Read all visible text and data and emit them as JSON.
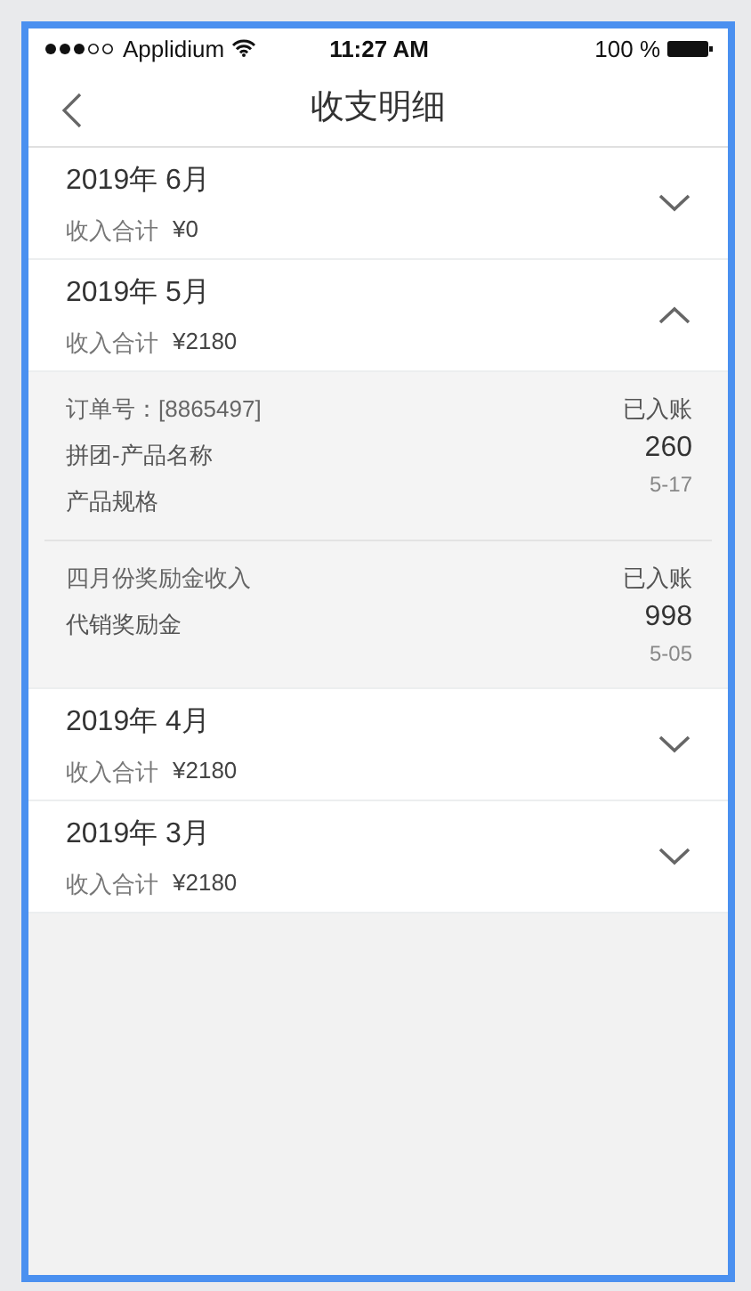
{
  "status_bar": {
    "carrier": "Applidium",
    "time": "11:27 AM",
    "battery": "100 %"
  },
  "nav": {
    "title": "收支明细"
  },
  "months": [
    {
      "month": "2019年 6月",
      "summary_label": "收入合计",
      "summary_amount": "¥0",
      "expanded": false
    },
    {
      "month": "2019年 5月",
      "summary_label": "收入合计",
      "summary_amount": "¥2180",
      "expanded": true,
      "records": [
        {
          "title": "订单号：[8865497]",
          "status": "已入账",
          "name": "拼团-产品名称",
          "amount": "260",
          "spec": "产品规格",
          "date": "5-17"
        },
        {
          "title": "四月份奖励金收入",
          "status": "已入账",
          "name": "代销奖励金",
          "amount": "998",
          "date": "5-05"
        }
      ]
    },
    {
      "month": "2019年 4月",
      "summary_label": "收入合计",
      "summary_amount": "¥2180",
      "expanded": false
    },
    {
      "month": "2019年 3月",
      "summary_label": "收入合计",
      "summary_amount": "¥2180",
      "expanded": false
    }
  ]
}
